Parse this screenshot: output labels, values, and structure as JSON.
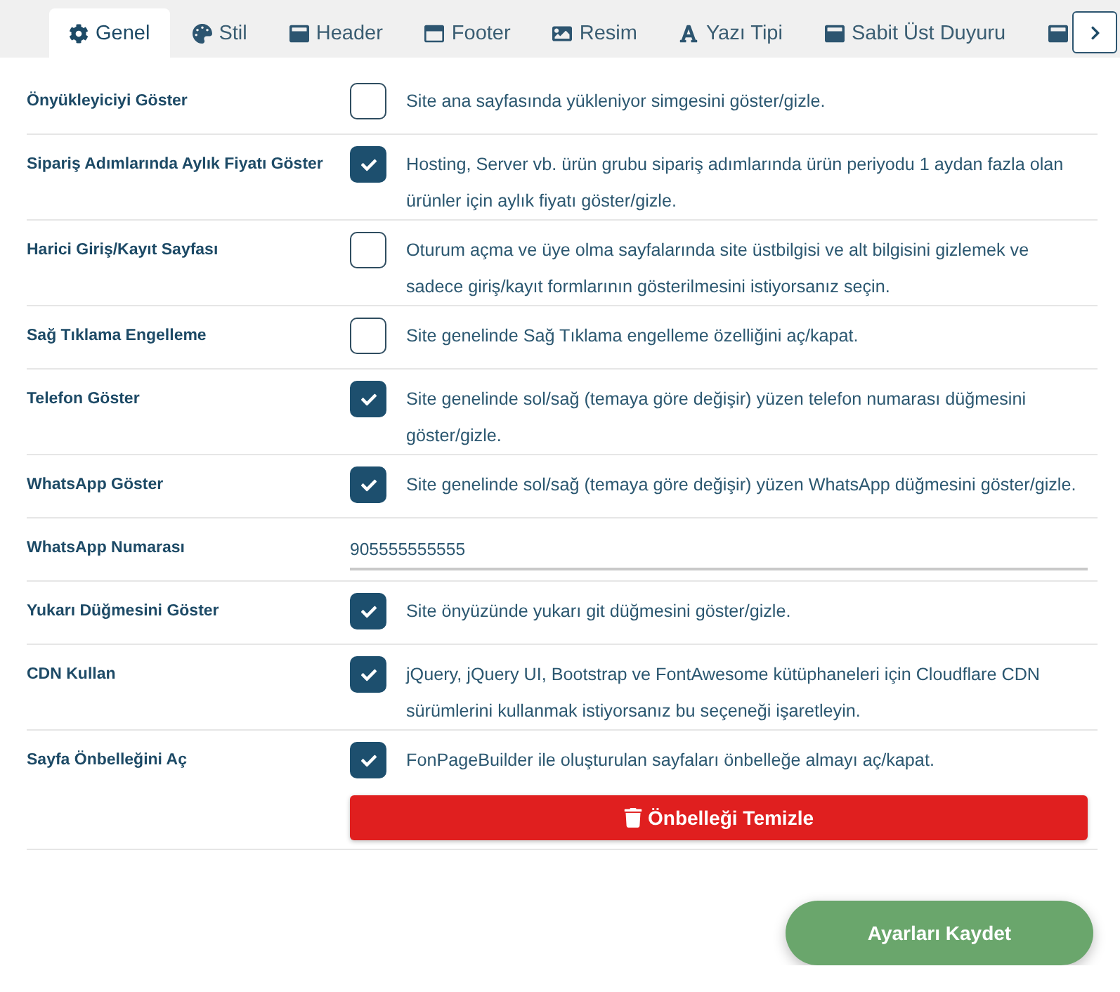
{
  "tabs": [
    {
      "label": "Genel",
      "selected": true
    },
    {
      "label": "Stil",
      "selected": false
    },
    {
      "label": "Header",
      "selected": false
    },
    {
      "label": "Footer",
      "selected": false
    },
    {
      "label": "Resim",
      "selected": false
    },
    {
      "label": "Yazı Tipi",
      "selected": false
    },
    {
      "label": "Sabit Üst Duyuru",
      "selected": false
    },
    {
      "selected": false
    }
  ],
  "settings": [
    {
      "kind": "checkbox",
      "label": "Önyükleyiciyi Göster",
      "checked": false,
      "description": "Site ana sayfasında yükleniyor simgesini göster/gizle."
    },
    {
      "kind": "checkbox",
      "label": "Sipariş Adımlarında Aylık Fiyatı Göster",
      "checked": true,
      "description": "Hosting, Server vb. ürün grubu sipariş adımlarında ürün periyodu 1 aydan fazla olan ürünler için aylık fiyatı göster/gizle."
    },
    {
      "kind": "checkbox",
      "label": "Harici Giriş/Kayıt Sayfası",
      "checked": false,
      "description": "Oturum açma ve üye olma sayfalarında site üstbilgisi ve alt bilgisini gizlemek ve sadece giriş/kayıt formlarının gösterilmesini istiyorsanız seçin."
    },
    {
      "kind": "checkbox",
      "label": "Sağ Tıklama Engelleme",
      "checked": false,
      "description": "Site genelinde Sağ Tıklama engelleme özelliğini aç/kapat."
    },
    {
      "kind": "checkbox",
      "label": "Telefon Göster",
      "checked": true,
      "description": "Site genelinde sol/sağ (temaya göre değişir) yüzen telefon numarası düğmesini göster/gizle."
    },
    {
      "kind": "checkbox",
      "label": "WhatsApp Göster",
      "checked": true,
      "description": "Site genelinde sol/sağ (temaya göre değişir) yüzen WhatsApp düğmesini göster/gizle."
    },
    {
      "kind": "text_input",
      "label": "WhatsApp Numarası",
      "value": "905555555555"
    },
    {
      "kind": "checkbox",
      "label": "Yukarı Düğmesini Göster",
      "checked": true,
      "description": "Site önyüzünde yukarı git düğmesini göster/gizle."
    },
    {
      "kind": "checkbox",
      "label": "CDN Kullan",
      "checked": true,
      "description": "jQuery, jQuery UI, Bootstrap ve FontAwesome kütüphaneleri için Cloudflare CDN sürümlerini kullanmak istiyorsanız bu seçeneği işaretleyin."
    },
    {
      "kind": "checkbox",
      "label": "Sayfa Önbelleğini Aç",
      "checked": true,
      "description": "FonPageBuilder ile oluşturulan sayfaları önbelleğe almayı aç/kapat.",
      "action": {
        "label": "Önbelleği Temizle"
      }
    }
  ],
  "save_button": {
    "label": "Ayarları Kaydet"
  }
}
